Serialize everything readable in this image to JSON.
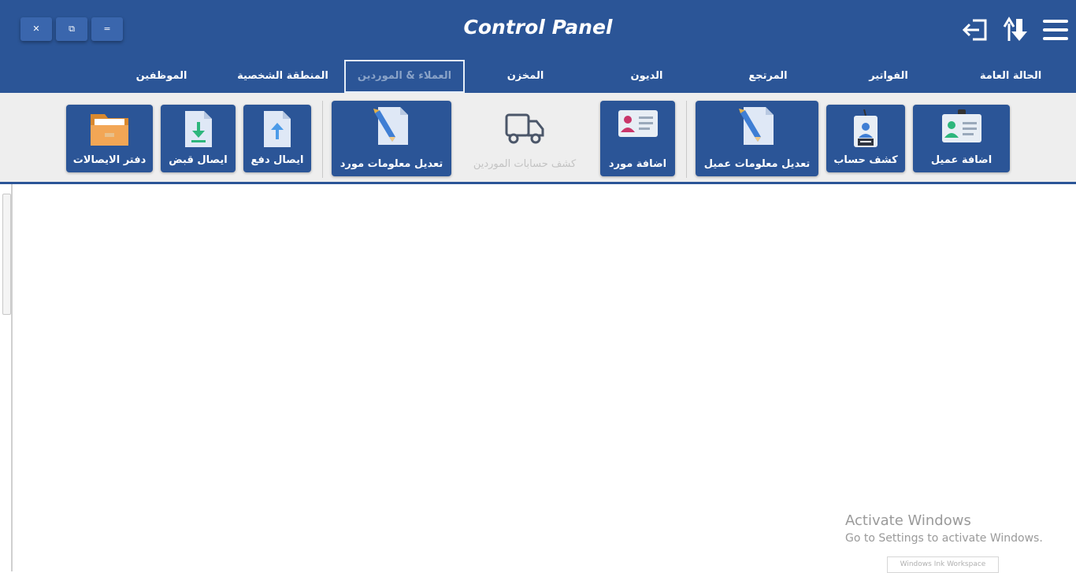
{
  "app": {
    "title": "Control Panel"
  },
  "window_controls": {
    "close": "✕",
    "restore": "⧉",
    "minimize": "="
  },
  "tabs": [
    {
      "label": "الحالة العامة"
    },
    {
      "label": "الفواتير"
    },
    {
      "label": "المرتجع"
    },
    {
      "label": "الديون"
    },
    {
      "label": "المخزن"
    },
    {
      "label": "العملاء & الموردين",
      "active": true
    },
    {
      "label": "المنطقة الشخصية"
    },
    {
      "label": "الموظفين"
    }
  ],
  "toolbar": {
    "buttons": [
      {
        "label": "اضافة عميل",
        "icon": "id-card-icon"
      },
      {
        "label": "كشف حساب",
        "icon": "badge-icon"
      },
      {
        "label": "تعديل معلومات عميل",
        "icon": "edit-document-icon"
      },
      {
        "label": "اضافة مورد",
        "icon": "id-card-icon"
      },
      {
        "label": "كشف حسابات الموردين",
        "icon": "truck-icon",
        "disabled": true
      },
      {
        "label": "تعديل معلومات مورد",
        "icon": "edit-document-icon"
      },
      {
        "label": "ايصال دفع",
        "icon": "upload-document-icon"
      },
      {
        "label": "ايصال قبض",
        "icon": "download-document-icon"
      },
      {
        "label": "دفتر الايصالات",
        "icon": "folder-icon"
      }
    ]
  },
  "watermark": {
    "title": "Activate Windows",
    "subtitle": "Go to Settings to activate Windows.",
    "box": "Windows Ink Workspace"
  },
  "colors": {
    "primary": "#2b5597",
    "toolbar_bg": "#eeeeee"
  }
}
